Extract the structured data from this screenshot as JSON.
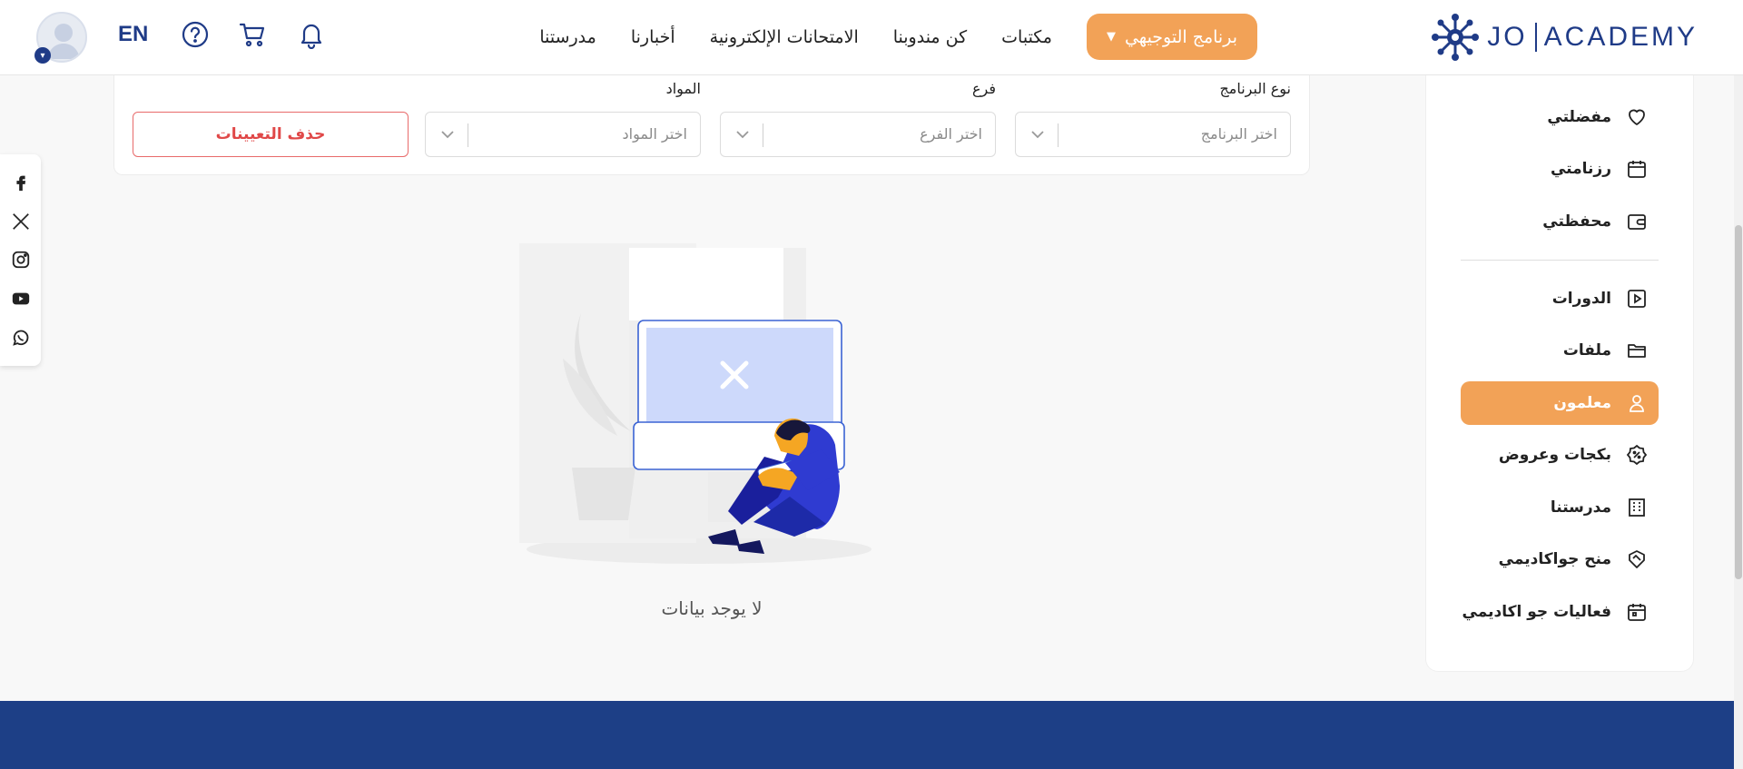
{
  "header": {
    "logo_left": "JO",
    "logo_right": "ACADEMY",
    "nav": {
      "our_school": "مدرستنا",
      "news": "أخبارنا",
      "exams": "الامتحانات الإلكترونية",
      "be_rep": "كن مندوبنا",
      "libraries": "مكتبات",
      "program_button": "برنامج التوجيهي"
    },
    "language": "EN",
    "icons": [
      "bell-icon",
      "cart-icon",
      "help-icon"
    ]
  },
  "filters": {
    "program_type_label": "نوع البرنامج",
    "program_placeholder": "اختر البرنامج",
    "branch_label": "فرع",
    "branch_placeholder": "اختر الفرع",
    "subjects_label": "المواد",
    "subjects_placeholder": "اختر المواد",
    "clear_button": "حذف التعيينات"
  },
  "empty_state": {
    "message": "لا يوجد بيانات"
  },
  "sidebar": {
    "items": [
      {
        "label": "مفضلتي",
        "icon": "heart-icon"
      },
      {
        "label": "رزنامتي",
        "icon": "calendar-icon"
      },
      {
        "label": "محفظتي",
        "icon": "wallet-icon"
      },
      {
        "label": "الدورات",
        "icon": "play-square-icon"
      },
      {
        "label": "ملفات",
        "icon": "folder-icon"
      },
      {
        "label": "معلمون",
        "icon": "teacher-icon",
        "active": true
      },
      {
        "label": "بكجات وعروض",
        "icon": "discount-badge-icon"
      },
      {
        "label": "مدرستنا",
        "icon": "building-icon"
      },
      {
        "label": "منح جواكاديمي",
        "icon": "handshake-icon"
      },
      {
        "label": "فعاليات جو اكاديمي",
        "icon": "event-calendar-icon"
      }
    ]
  },
  "social": [
    "facebook-icon",
    "x-icon",
    "instagram-icon",
    "youtube-icon",
    "whatsapp-icon"
  ],
  "colors": {
    "accent": "#f2a257",
    "brand": "#1f3b87",
    "footer": "#1d3f86",
    "danger": "#e04848"
  }
}
